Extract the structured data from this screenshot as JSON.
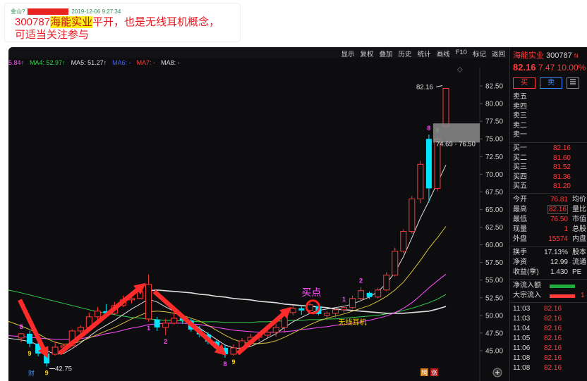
{
  "post": {
    "author": "金山?",
    "date": "2019-12-06 9:27:34",
    "stock_code": "300787",
    "stock_name": "海能实业",
    "text": "平开，也是无线耳机概念，可适当关注参与"
  },
  "menu": [
    "显示",
    "复权",
    "叠加",
    "历史",
    "统计",
    "画线",
    "F10",
    "标记",
    "返回"
  ],
  "ma_bar": [
    {
      "label": "5.84↑",
      "color": "#ff4dff"
    },
    {
      "label": "MA4: 52.97↑",
      "color": "#32d34d"
    },
    {
      "label": "MA5: 51.27↑",
      "color": "#dddddd"
    },
    {
      "label": "MA6: -",
      "color": "#4060ff"
    },
    {
      "label": "MA7: -",
      "color": "#ff3b3b"
    },
    {
      "label": "MA8: -",
      "color": "#dddddd"
    }
  ],
  "chart_data": {
    "type": "candlestick",
    "y_ticks": [
      "82.50",
      "80.00",
      "77.50",
      "75.00",
      "72.50",
      "70.00",
      "67.50",
      "65.00",
      "62.50",
      "60.00",
      "57.50",
      "55.00",
      "52.50",
      "50.00",
      "47.50",
      "45.00"
    ],
    "ylim": [
      43.3,
      85.2
    ],
    "candles": [
      {
        "o": 46.8,
        "h": 47.5,
        "l": 46.2,
        "c": 47.4
      },
      {
        "o": 47.4,
        "h": 47.8,
        "l": 45.5,
        "c": 46.0
      },
      {
        "o": 46.0,
        "h": 46.3,
        "l": 44.2,
        "c": 44.6
      },
      {
        "o": 44.6,
        "h": 44.8,
        "l": 42.75,
        "c": 43.2
      },
      {
        "o": 44.5,
        "h": 46.3,
        "l": 44.3,
        "c": 45.5
      },
      {
        "o": 45.5,
        "h": 46.0,
        "l": 45.0,
        "c": 45.7
      },
      {
        "o": 45.7,
        "h": 48.0,
        "l": 45.6,
        "c": 47.8
      },
      {
        "o": 47.8,
        "h": 48.6,
        "l": 47.5,
        "c": 48.3
      },
      {
        "o": 48.3,
        "h": 50.4,
        "l": 48.2,
        "c": 49.8
      },
      {
        "o": 49.8,
        "h": 51.2,
        "l": 49.2,
        "c": 50.6
      },
      {
        "o": 50.6,
        "h": 51.6,
        "l": 50.0,
        "c": 50.3
      },
      {
        "o": 50.3,
        "h": 51.9,
        "l": 50.1,
        "c": 51.4
      },
      {
        "o": 51.4,
        "h": 52.8,
        "l": 51.2,
        "c": 52.2
      },
      {
        "o": 52.2,
        "h": 53.0,
        "l": 51.7,
        "c": 52.4
      },
      {
        "o": 52.4,
        "h": 54.2,
        "l": 52.3,
        "c": 53.4
      },
      {
        "o": 49.5,
        "h": 55.8,
        "l": 49.1,
        "c": 54.4
      },
      {
        "o": 49.4,
        "h": 49.8,
        "l": 47.8,
        "c": 48.3
      },
      {
        "o": 48.3,
        "h": 49.5,
        "l": 47.2,
        "c": 48.9
      },
      {
        "o": 48.9,
        "h": 50.6,
        "l": 48.7,
        "c": 49.6
      },
      {
        "o": 49.6,
        "h": 50.2,
        "l": 48.8,
        "c": 49.3
      },
      {
        "o": 49.3,
        "h": 49.6,
        "l": 47.7,
        "c": 48.0
      },
      {
        "o": 48.0,
        "h": 48.5,
        "l": 46.9,
        "c": 47.3
      },
      {
        "o": 47.3,
        "h": 47.6,
        "l": 45.9,
        "c": 46.3
      },
      {
        "o": 46.3,
        "h": 46.5,
        "l": 45.0,
        "c": 45.4
      },
      {
        "o": 45.4,
        "h": 45.8,
        "l": 44.0,
        "c": 44.5
      },
      {
        "o": 44.5,
        "h": 45.9,
        "l": 44.3,
        "c": 45.4
      },
      {
        "o": 45.4,
        "h": 46.8,
        "l": 45.2,
        "c": 46.4
      },
      {
        "o": 46.4,
        "h": 47.4,
        "l": 46.0,
        "c": 46.9
      },
      {
        "o": 46.9,
        "h": 47.6,
        "l": 46.4,
        "c": 47.2
      },
      {
        "o": 47.2,
        "h": 47.9,
        "l": 46.8,
        "c": 47.6
      },
      {
        "o": 47.6,
        "h": 48.8,
        "l": 47.0,
        "c": 48.3
      },
      {
        "o": 48.3,
        "h": 50.6,
        "l": 47.5,
        "c": 50.4
      },
      {
        "o": 50.4,
        "h": 51.4,
        "l": 50.0,
        "c": 51.0
      },
      {
        "o": 51.0,
        "h": 51.5,
        "l": 50.1,
        "c": 50.7
      },
      {
        "o": 50.7,
        "h": 51.8,
        "l": 50.3,
        "c": 51.5
      },
      {
        "o": 51.3,
        "h": 51.5,
        "l": 50.0,
        "c": 50.2
      },
      {
        "o": 50.0,
        "h": 50.6,
        "l": 49.3,
        "c": 50.3
      },
      {
        "o": 50.3,
        "h": 51.0,
        "l": 49.7,
        "c": 50.8
      },
      {
        "o": 50.8,
        "h": 51.4,
        "l": 50.4,
        "c": 51.1
      },
      {
        "o": 51.1,
        "h": 52.8,
        "l": 50.9,
        "c": 52.4
      },
      {
        "o": 52.4,
        "h": 54.0,
        "l": 52.0,
        "c": 53.5
      },
      {
        "o": 53.2,
        "h": 53.4,
        "l": 52.3,
        "c": 52.6
      },
      {
        "o": 52.6,
        "h": 53.9,
        "l": 52.4,
        "c": 53.6
      },
      {
        "o": 53.6,
        "h": 56.1,
        "l": 53.4,
        "c": 55.7
      },
      {
        "o": 55.7,
        "h": 59.6,
        "l": 55.5,
        "c": 59.1
      },
      {
        "o": 59.1,
        "h": 62.2,
        "l": 58.8,
        "c": 61.9
      },
      {
        "o": 61.9,
        "h": 66.9,
        "l": 61.6,
        "c": 66.5
      },
      {
        "o": 66.5,
        "h": 71.9,
        "l": 65.9,
        "c": 71.4
      },
      {
        "o": 75.0,
        "h": 75.6,
        "l": 66.0,
        "c": 68.0
      },
      {
        "o": 68.0,
        "h": 75.3,
        "l": 67.6,
        "c": 75.0
      },
      {
        "o": 76.81,
        "h": 82.16,
        "l": 76.5,
        "c": 82.16
      }
    ],
    "ma_lines": [
      {
        "color": "#32d34d",
        "values": [
          53.2,
          52.9,
          52.6,
          52.3,
          52.0,
          51.7,
          51.4,
          51.1,
          50.8,
          50.5,
          50.3,
          50.1,
          49.9,
          49.7,
          49.6,
          49.5,
          49.4,
          49.3,
          49.3,
          49.2,
          49.2,
          49.1,
          49.1,
          49.1,
          49.0,
          49.0,
          49.0,
          49.0,
          49.1,
          49.1,
          49.2,
          49.2,
          49.3,
          49.3,
          49.4,
          49.4,
          49.5,
          49.5,
          49.6,
          49.7,
          49.8,
          49.9,
          50.0,
          50.2,
          50.4,
          50.7,
          51.0,
          51.4,
          51.8,
          52.3,
          52.97
        ]
      },
      {
        "color": "#dddddd",
        "values": [
          null,
          null,
          null,
          null,
          null,
          null,
          null,
          null,
          null,
          null,
          null,
          null,
          null,
          null,
          null,
          53.5,
          53.6,
          53.5,
          53.4,
          53.3,
          53.2,
          53.0,
          52.9,
          52.7,
          52.6,
          52.4,
          52.3,
          52.2,
          52.0,
          51.9,
          51.8,
          51.6,
          51.5,
          51.4,
          51.3,
          51.2,
          51.1,
          50.9,
          50.8,
          50.7,
          50.6,
          50.5,
          50.4,
          50.3,
          50.3,
          50.3,
          50.4,
          50.5,
          50.6,
          50.9,
          51.27
        ]
      },
      {
        "color": "#ff4dff",
        "values": [
          47.0,
          46.9,
          46.8,
          46.7,
          46.6,
          46.6,
          46.6,
          46.7,
          46.9,
          47.1,
          47.4,
          47.6,
          47.9,
          48.2,
          48.4,
          48.7,
          48.8,
          48.9,
          48.9,
          48.9,
          48.8,
          48.7,
          48.5,
          48.3,
          48.1,
          47.9,
          47.8,
          47.7,
          47.6,
          47.6,
          47.6,
          47.7,
          47.8,
          48.0,
          48.1,
          48.3,
          48.4,
          48.6,
          48.7,
          48.9,
          49.1,
          49.3,
          49.6,
          49.9,
          50.4,
          51.0,
          51.8,
          52.8,
          53.9,
          54.9,
          55.84
        ]
      },
      {
        "color": "#d9c23a",
        "values": [
          48.5,
          48.0,
          47.4,
          46.7,
          46.2,
          45.9,
          46.0,
          46.3,
          46.8,
          47.3,
          47.8,
          48.3,
          48.9,
          49.5,
          50.0,
          50.5,
          50.6,
          50.5,
          50.3,
          50.0,
          49.6,
          49.2,
          48.6,
          47.9,
          47.2,
          46.6,
          46.2,
          46.0,
          46.0,
          46.1,
          46.4,
          46.9,
          47.5,
          48.1,
          48.7,
          49.2,
          49.6,
          49.9,
          50.2,
          50.6,
          51.0,
          51.4,
          52.0,
          52.7,
          53.6,
          54.7,
          56.2,
          57.8,
          59.5,
          61.0,
          62.6
        ]
      },
      {
        "color": "#dddddd",
        "values": [
          46.5,
          46.3,
          45.8,
          45.0,
          44.5,
          44.6,
          45.3,
          46.1,
          47.0,
          47.9,
          48.6,
          49.3,
          50.1,
          50.9,
          51.6,
          52.3,
          51.9,
          51.2,
          50.6,
          49.8,
          49.0,
          48.2,
          47.4,
          46.6,
          45.8,
          45.4,
          45.3,
          45.6,
          46.1,
          46.8,
          47.4,
          48.3,
          49.1,
          49.7,
          50.3,
          50.7,
          50.9,
          51.1,
          51.3,
          51.6,
          52.1,
          52.6,
          53.4,
          54.5,
          56.1,
          58.3,
          61.0,
          63.8,
          66.2,
          68.8,
          71.3
        ]
      }
    ],
    "counters": [
      {
        "i": 0,
        "text": "8",
        "color": "#ff4dff",
        "pos": "above"
      },
      {
        "i": 1,
        "text": "9",
        "color": "#ffd400",
        "pos": "below"
      },
      {
        "i": 3,
        "text": "9",
        "color": "#ffd400",
        "pos": "below"
      },
      {
        "i": 15,
        "text": "1",
        "color": "#ff4dff",
        "pos": "below"
      },
      {
        "i": 17,
        "text": "2",
        "color": "#ff4dff",
        "pos": "below"
      },
      {
        "i": 24,
        "text": "8",
        "color": "#ff4dff",
        "pos": "below"
      },
      {
        "i": 25,
        "text": "9",
        "color": "#ffd400",
        "pos": "below"
      },
      {
        "i": 38,
        "text": "1",
        "color": "#ff4dff",
        "pos": "above"
      },
      {
        "i": 40,
        "text": "2",
        "color": "#ff4dff",
        "pos": "above"
      },
      {
        "i": 48,
        "text": "8",
        "color": "#ff4dff",
        "pos": "above"
      },
      {
        "i": 49,
        "text": "9",
        "color": "#32d34d",
        "pos": "above"
      }
    ],
    "annotations": {
      "high_label": "82.16",
      "low_label": "42.75",
      "range_label": "74.69 - 76.50",
      "buy_point": "买点",
      "concept": "无线耳机",
      "badge_cai": "财",
      "badge_teng": "腾",
      "badge_zhang": "涨"
    },
    "colors": {
      "up": "#ff3b3b",
      "down": "#00e5ff"
    }
  },
  "side": {
    "name": "海能实业",
    "code": "300787",
    "flag": "N",
    "price": "82.16",
    "change": "7.47",
    "pct": "10.00%",
    "buy_btn": "买",
    "sell_btn": "卖",
    "more_btn": "",
    "asks": [
      {
        "label": "卖五",
        "price": ""
      },
      {
        "label": "卖四",
        "price": ""
      },
      {
        "label": "卖三",
        "price": ""
      },
      {
        "label": "卖二",
        "price": ""
      },
      {
        "label": "卖一",
        "price": ""
      }
    ],
    "bids": [
      {
        "label": "买一",
        "price": "82.16"
      },
      {
        "label": "买二",
        "price": "81.60"
      },
      {
        "label": "买三",
        "price": "81.52"
      },
      {
        "label": "买四",
        "price": "81.36"
      },
      {
        "label": "买五",
        "price": "81.20"
      }
    ],
    "info": [
      {
        "label": "今开",
        "value": "76.81",
        "label2": "均价",
        "cls": "red"
      },
      {
        "label": "最高",
        "value": "82.16",
        "label2": "量比",
        "cls": "red",
        "boxed": true
      },
      {
        "label": "最低",
        "value": "76.50",
        "label2": "市值",
        "cls": "red"
      },
      {
        "label": "现量",
        "value": "1",
        "label2": "总股",
        "cls": "red"
      },
      {
        "label": "外盘",
        "value": "15574",
        "label2": "内盘",
        "cls": "red"
      }
    ],
    "info2": [
      {
        "label": "换手",
        "value": "17.13%",
        "label2": "股本",
        "cls": "white"
      },
      {
        "label": "净资",
        "value": "12.99",
        "label2": "流通",
        "cls": "white"
      },
      {
        "label": "收益(季)",
        "value": "1.430",
        "label2": "PE",
        "cls": "white"
      }
    ],
    "flows": [
      {
        "label": "净流入额",
        "color": "green",
        "value": ""
      },
      {
        "label": "大宗流入",
        "color": "red",
        "value": "1"
      }
    ],
    "ticks": [
      {
        "t": "11:03",
        "p": "82.16"
      },
      {
        "t": "11:03",
        "p": "82.16"
      },
      {
        "t": "11:04",
        "p": "82.16"
      },
      {
        "t": "11:05",
        "p": "82.16"
      },
      {
        "t": "11:06",
        "p": "82.16"
      },
      {
        "t": "11:08",
        "p": "82.16"
      },
      {
        "t": "11:08",
        "p": "82.16"
      }
    ]
  }
}
